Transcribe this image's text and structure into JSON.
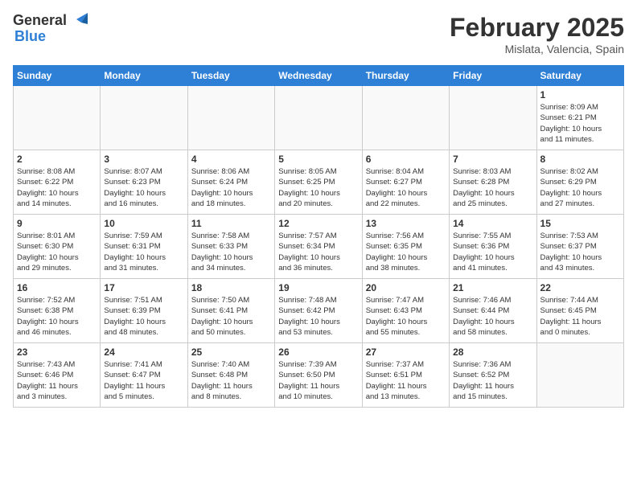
{
  "header": {
    "logo_general": "General",
    "logo_blue": "Blue",
    "title": "February 2025",
    "subtitle": "Mislata, Valencia, Spain"
  },
  "weekdays": [
    "Sunday",
    "Monday",
    "Tuesday",
    "Wednesday",
    "Thursday",
    "Friday",
    "Saturday"
  ],
  "weeks": [
    [
      {
        "day": "",
        "info": ""
      },
      {
        "day": "",
        "info": ""
      },
      {
        "day": "",
        "info": ""
      },
      {
        "day": "",
        "info": ""
      },
      {
        "day": "",
        "info": ""
      },
      {
        "day": "",
        "info": ""
      },
      {
        "day": "1",
        "info": "Sunrise: 8:09 AM\nSunset: 6:21 PM\nDaylight: 10 hours\nand 11 minutes."
      }
    ],
    [
      {
        "day": "2",
        "info": "Sunrise: 8:08 AM\nSunset: 6:22 PM\nDaylight: 10 hours\nand 14 minutes."
      },
      {
        "day": "3",
        "info": "Sunrise: 8:07 AM\nSunset: 6:23 PM\nDaylight: 10 hours\nand 16 minutes."
      },
      {
        "day": "4",
        "info": "Sunrise: 8:06 AM\nSunset: 6:24 PM\nDaylight: 10 hours\nand 18 minutes."
      },
      {
        "day": "5",
        "info": "Sunrise: 8:05 AM\nSunset: 6:25 PM\nDaylight: 10 hours\nand 20 minutes."
      },
      {
        "day": "6",
        "info": "Sunrise: 8:04 AM\nSunset: 6:27 PM\nDaylight: 10 hours\nand 22 minutes."
      },
      {
        "day": "7",
        "info": "Sunrise: 8:03 AM\nSunset: 6:28 PM\nDaylight: 10 hours\nand 25 minutes."
      },
      {
        "day": "8",
        "info": "Sunrise: 8:02 AM\nSunset: 6:29 PM\nDaylight: 10 hours\nand 27 minutes."
      }
    ],
    [
      {
        "day": "9",
        "info": "Sunrise: 8:01 AM\nSunset: 6:30 PM\nDaylight: 10 hours\nand 29 minutes."
      },
      {
        "day": "10",
        "info": "Sunrise: 7:59 AM\nSunset: 6:31 PM\nDaylight: 10 hours\nand 31 minutes."
      },
      {
        "day": "11",
        "info": "Sunrise: 7:58 AM\nSunset: 6:33 PM\nDaylight: 10 hours\nand 34 minutes."
      },
      {
        "day": "12",
        "info": "Sunrise: 7:57 AM\nSunset: 6:34 PM\nDaylight: 10 hours\nand 36 minutes."
      },
      {
        "day": "13",
        "info": "Sunrise: 7:56 AM\nSunset: 6:35 PM\nDaylight: 10 hours\nand 38 minutes."
      },
      {
        "day": "14",
        "info": "Sunrise: 7:55 AM\nSunset: 6:36 PM\nDaylight: 10 hours\nand 41 minutes."
      },
      {
        "day": "15",
        "info": "Sunrise: 7:53 AM\nSunset: 6:37 PM\nDaylight: 10 hours\nand 43 minutes."
      }
    ],
    [
      {
        "day": "16",
        "info": "Sunrise: 7:52 AM\nSunset: 6:38 PM\nDaylight: 10 hours\nand 46 minutes."
      },
      {
        "day": "17",
        "info": "Sunrise: 7:51 AM\nSunset: 6:39 PM\nDaylight: 10 hours\nand 48 minutes."
      },
      {
        "day": "18",
        "info": "Sunrise: 7:50 AM\nSunset: 6:41 PM\nDaylight: 10 hours\nand 50 minutes."
      },
      {
        "day": "19",
        "info": "Sunrise: 7:48 AM\nSunset: 6:42 PM\nDaylight: 10 hours\nand 53 minutes."
      },
      {
        "day": "20",
        "info": "Sunrise: 7:47 AM\nSunset: 6:43 PM\nDaylight: 10 hours\nand 55 minutes."
      },
      {
        "day": "21",
        "info": "Sunrise: 7:46 AM\nSunset: 6:44 PM\nDaylight: 10 hours\nand 58 minutes."
      },
      {
        "day": "22",
        "info": "Sunrise: 7:44 AM\nSunset: 6:45 PM\nDaylight: 11 hours\nand 0 minutes."
      }
    ],
    [
      {
        "day": "23",
        "info": "Sunrise: 7:43 AM\nSunset: 6:46 PM\nDaylight: 11 hours\nand 3 minutes."
      },
      {
        "day": "24",
        "info": "Sunrise: 7:41 AM\nSunset: 6:47 PM\nDaylight: 11 hours\nand 5 minutes."
      },
      {
        "day": "25",
        "info": "Sunrise: 7:40 AM\nSunset: 6:48 PM\nDaylight: 11 hours\nand 8 minutes."
      },
      {
        "day": "26",
        "info": "Sunrise: 7:39 AM\nSunset: 6:50 PM\nDaylight: 11 hours\nand 10 minutes."
      },
      {
        "day": "27",
        "info": "Sunrise: 7:37 AM\nSunset: 6:51 PM\nDaylight: 11 hours\nand 13 minutes."
      },
      {
        "day": "28",
        "info": "Sunrise: 7:36 AM\nSunset: 6:52 PM\nDaylight: 11 hours\nand 15 minutes."
      },
      {
        "day": "",
        "info": ""
      }
    ]
  ]
}
